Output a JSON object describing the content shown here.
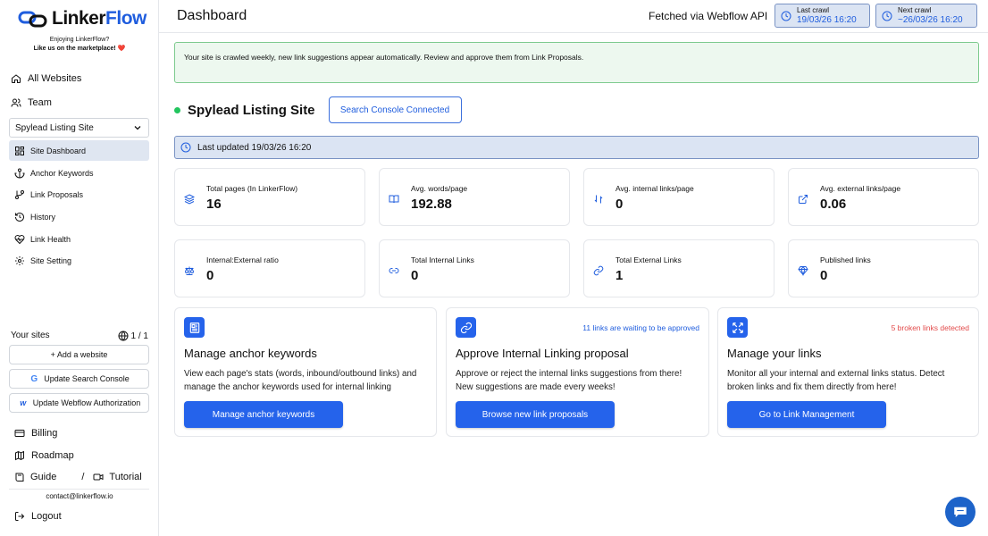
{
  "brand": {
    "name_part1": "Linker",
    "name_part2": "Flow",
    "enjoy_line1": "Enjoying LinkerFlow?",
    "enjoy_line2": "Like us on the marketplace! ❤️"
  },
  "sidebar": {
    "top_items": [
      {
        "label": "All Websites",
        "icon": "home-icon"
      },
      {
        "label": "Team",
        "icon": "users-icon"
      }
    ],
    "site_selector": "Spylead Listing Site",
    "site_items": [
      {
        "label": "Site Dashboard",
        "icon": "dashboard-icon",
        "active": true
      },
      {
        "label": "Anchor Keywords",
        "icon": "anchor-icon"
      },
      {
        "label": "Link Proposals",
        "icon": "proposals-icon"
      },
      {
        "label": "History",
        "icon": "history-icon"
      },
      {
        "label": "Link Health",
        "icon": "heart-pulse-icon"
      },
      {
        "label": "Site Setting",
        "icon": "gear-icon"
      }
    ],
    "your_sites_label": "Your sites",
    "your_sites_count": "1 / 1",
    "add_website": "+ Add a website",
    "update_gsc": "Update Search Console",
    "update_webflow": "Update Webflow Authorization",
    "billing": "Billing",
    "roadmap": "Roadmap",
    "guide": "Guide",
    "sep": "/",
    "tutorial": "Tutorial",
    "contact": "contact@linkerflow.io",
    "logout": "Logout"
  },
  "header": {
    "title": "Dashboard",
    "fetched": "Fetched via Webflow API",
    "last_crawl_label": "Last crawl",
    "last_crawl_value": "19/03/26 16:20",
    "next_crawl_label": "Next crawl",
    "next_crawl_value": "~26/03/26 16:20"
  },
  "notice": "Your site is crawled weekly, new link suggestions appear automatically. Review and approve them from Link Proposals.",
  "site": {
    "name": "Spylead Listing Site",
    "gsc_button": "Search Console Connected",
    "last_updated": "Last updated 19/03/26 16:20"
  },
  "stats": [
    {
      "label": "Total pages (In LinkerFlow)",
      "value": "16",
      "icon": "layers-icon"
    },
    {
      "label": "Avg. words/page",
      "value": "192.88",
      "icon": "book-icon"
    },
    {
      "label": "Avg. internal links/page",
      "value": "0",
      "icon": "link-arrows-icon"
    },
    {
      "label": "Avg. external links/page",
      "value": "0.06",
      "icon": "external-link-icon"
    },
    {
      "label": "Internal:External ratio",
      "value": "0",
      "icon": "scale-icon"
    },
    {
      "label": "Total Internal Links",
      "value": "0",
      "icon": "link-icon"
    },
    {
      "label": "Total External Links",
      "value": "1",
      "icon": "chain-icon"
    },
    {
      "label": "Published links",
      "value": "0",
      "icon": "diamond-icon"
    }
  ],
  "cards": [
    {
      "title": "Manage anchor keywords",
      "badge": "",
      "desc": "View each page's stats (words, inbound/outbound links) and manage the anchor keywords used for internal linking",
      "button": "Manage anchor keywords",
      "icon": "newspaper-icon"
    },
    {
      "title": "Approve Internal Linking proposal",
      "badge": "11 links are waiting to be approved",
      "desc": "Approve or reject the internal links suggestions from there! New suggestions are made every weeks!",
      "button": "Browse new link proposals",
      "icon": "link-icon"
    },
    {
      "title": "Manage your links",
      "badge": "5 broken links detected",
      "desc": "Monitor all your internal and external links status. Detect broken links and fix them directly from here!",
      "button": "Go to Link Management",
      "icon": "expand-icon"
    }
  ],
  "colors": {
    "accent": "#2563eb",
    "badge_blue": "#1f5dde",
    "badge_red": "#e24b4b",
    "status_green": "#22c55e"
  }
}
